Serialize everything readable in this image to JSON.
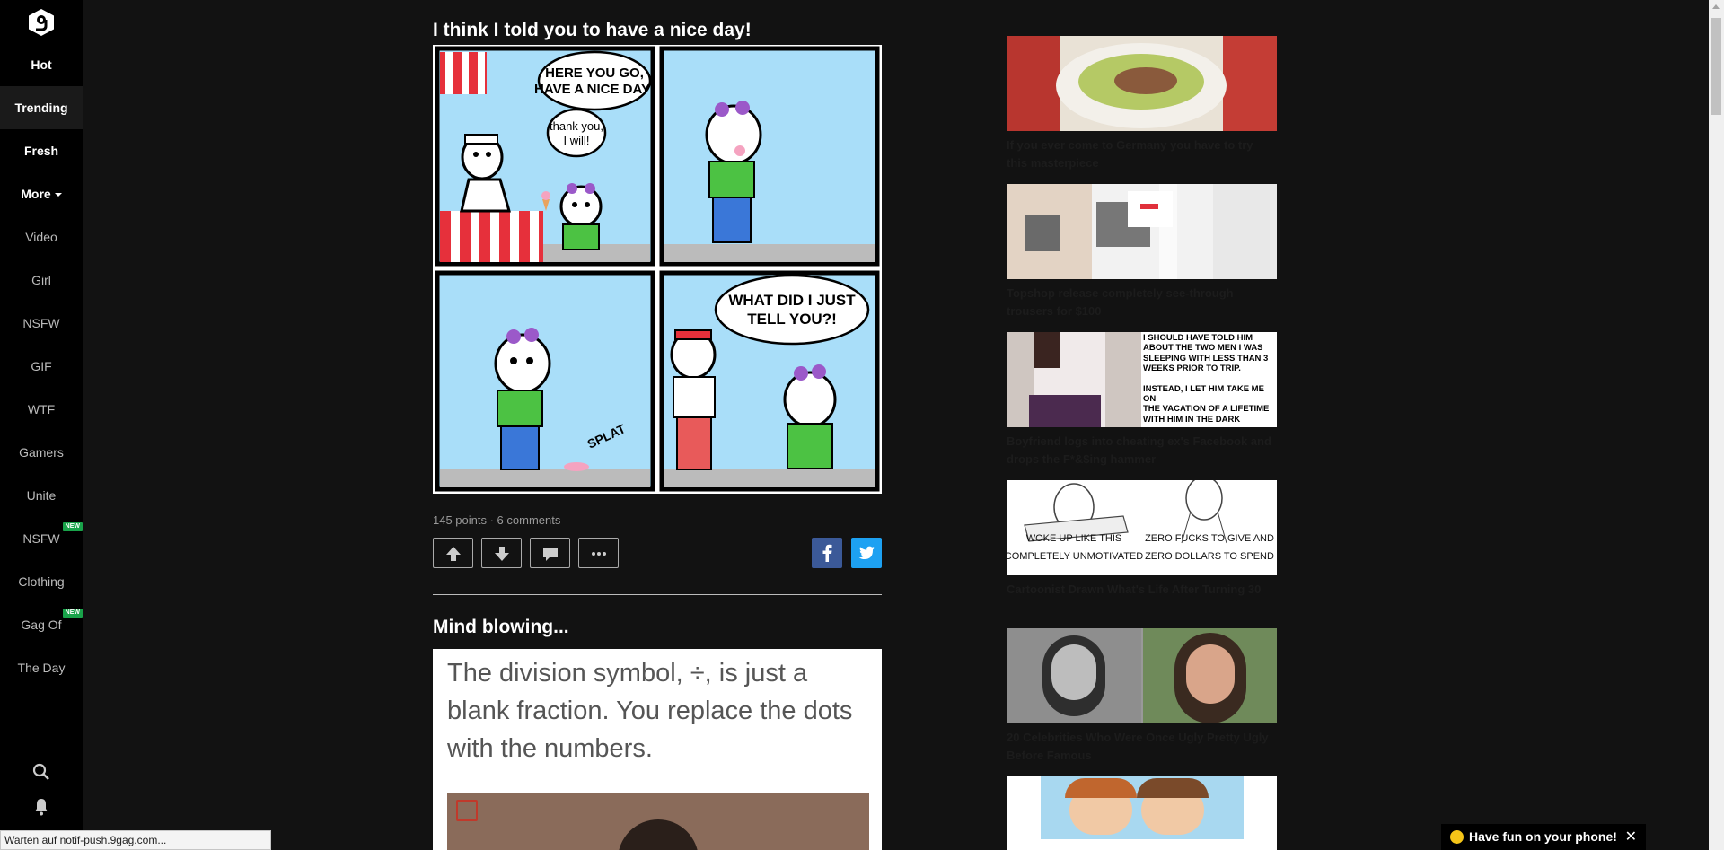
{
  "sidebar": {
    "logo": "9gag-logo",
    "items": [
      {
        "label": "Hot"
      },
      {
        "label": "Trending"
      },
      {
        "label": "Fresh"
      },
      {
        "label": "More"
      },
      {
        "label": "Video"
      },
      {
        "label": "Girl"
      },
      {
        "label": "NSFW"
      },
      {
        "label": "GIF"
      },
      {
        "label": "WTF"
      },
      {
        "label": "Gamers"
      },
      {
        "label": "Unite"
      },
      {
        "label": "NSFW",
        "badge": "NEW"
      },
      {
        "label": "Clothing"
      },
      {
        "label": "Gag Of",
        "badge": "NEW"
      },
      {
        "label": "The Day"
      }
    ],
    "search_icon": "search-icon",
    "notification_icon": "bell-icon"
  },
  "posts": [
    {
      "title": "I think I told you to have a nice day!",
      "comic": {
        "bubble1": [
          "HERE YOU GO,",
          "HAVE A NICE DAY!"
        ],
        "bubble2": [
          "thank you,",
          "I will!"
        ],
        "bubble3": [
          "WHAT DID I JUST",
          "TELL YOU?!"
        ],
        "sfx": "SPLAT"
      },
      "meta": "145 points · 6 comments"
    },
    {
      "title": "Mind blowing...",
      "text": "The division symbol, ÷, is just a blank fraction. You replace the dots with the numbers."
    }
  ],
  "related": [
    {
      "title": "If you ever come to Germany you have to try this masterpiece"
    },
    {
      "title": "Topshop release completely see-through trousers for $100"
    },
    {
      "title": "Boyfriend logs into cheating ex's Facebook and drops the F*&$ing hammer",
      "thumb_text": [
        "I SHOULD HAVE TOLD HIM",
        "ABOUT THE TWO MEN I WAS",
        "SLEEPING WITH LESS THAN 3",
        "WEEKS PRIOR TO TRIP.",
        "",
        "INSTEAD, I LET HIM TAKE ME ON",
        "THE VACATION OF A LIFETIME",
        "WITH HIM IN THE DARK"
      ]
    },
    {
      "title": "Cartoonist Drawn What's Life After Turning 30",
      "thumb_text": [
        "WOKE UP LIKE THIS",
        "COMPLETELY UNMOTIVATED",
        "ZERO FUCKS TO GIVE AND",
        "ZERO DOLLARS TO SPEND"
      ]
    },
    {
      "title": "20 Celebrities Who Were Once Ugly Pretty Ugly Before Famous"
    },
    {
      "title": ""
    }
  ],
  "status_bar": "Warten auf notif-push.9gag.com...",
  "promo": {
    "label": "Have fun on your phone!",
    "close": "✕"
  },
  "colors": {
    "background": "#121212",
    "sidebar": "#000000",
    "new_badge": "#19a34a",
    "facebook": "#3b5998",
    "twitter": "#1da1f2"
  }
}
